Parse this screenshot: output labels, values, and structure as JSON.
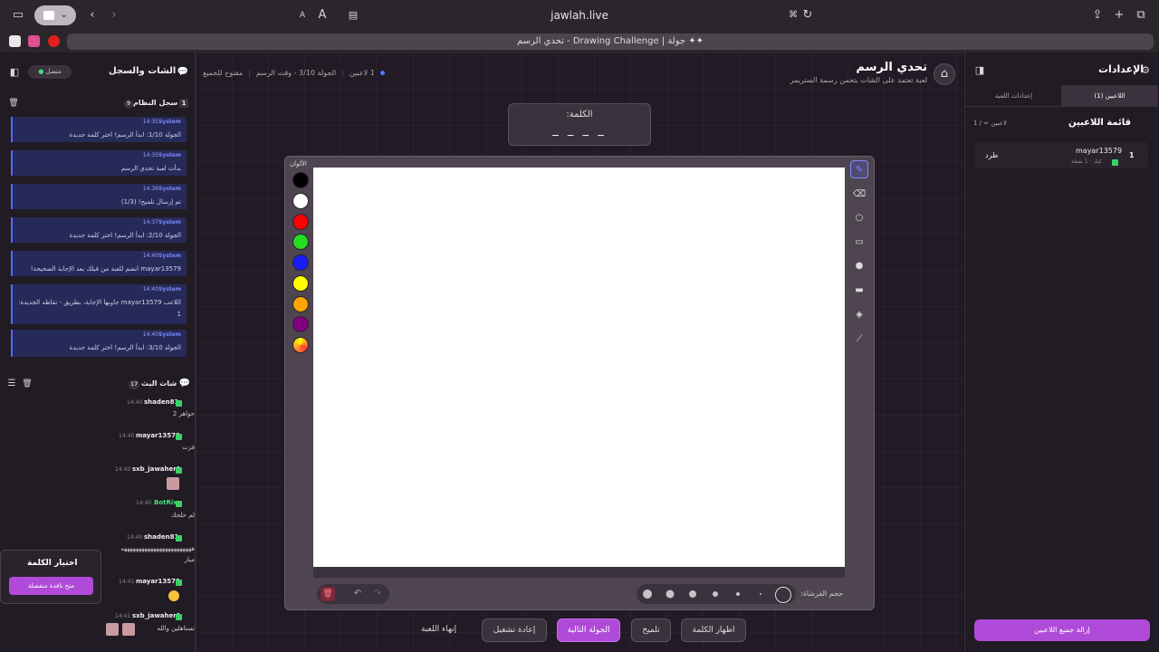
{
  "browser": {
    "url": "jawlah.live",
    "tab_title": "تحدي الرسم - Drawing Challenge | جولة ✦✦",
    "reader_a_small": "A",
    "reader_a_large": "A"
  },
  "header": {
    "title": "تحدي الرسم",
    "subtitle": "لعبة تعتمد على الشات بتخمن رسمة الستريمر",
    "players_count": "1 لاعبين",
    "round_info": "الجولة 3/10 - وقت الرسم",
    "access": "مفتوح للجميع"
  },
  "word_box": {
    "label": "الكلمة:",
    "dashes": "_ _ _ _"
  },
  "colors": {
    "label": "الألوان",
    "swatches": [
      "#000000",
      "#ffffff",
      "#ff0000",
      "#22dd22",
      "#1a1aff",
      "#ffff00",
      "#ffa500",
      "#800080"
    ]
  },
  "tools": [
    "pen-icon",
    "eraser-icon",
    "circle-icon",
    "rect-icon",
    "filled-circle-icon",
    "filled-rect-icon",
    "fill-bucket-icon",
    "line-icon"
  ],
  "brush": {
    "label": "حجم الفرشاة:"
  },
  "actions": {
    "show_word": "اظهار الكلمة",
    "hint": "تلميح",
    "next_round": "الجولة التالية",
    "restart": "إعادة تشغيل",
    "end_game": "إنهاء اللعبة"
  },
  "left_panel": {
    "title": "الشات والسجل",
    "online": "متصل",
    "system_log_title": "سجل النظام",
    "system_log_count": "9",
    "system_log_index": "1",
    "system_items": [
      {
        "name": "System",
        "time": "14:35",
        "text": "الجولة 1/10: ابدأ الرسم! اختر كلمة جديدة"
      },
      {
        "name": "System",
        "time": "14:35",
        "text": "بدأت لعبة تحدي الرسم"
      },
      {
        "name": "System",
        "time": "14:36",
        "text": "تم إرسال تلميح! (1/3)"
      },
      {
        "name": "System",
        "time": "14:37",
        "text": "الجولة 2/10: ابدأ الرسم! اختر كلمة جديدة"
      },
      {
        "name": "System",
        "time": "14:40",
        "text": "mayar13579 انضم للعبة من قبلك بعد الإجابة الصحيحة!"
      },
      {
        "name": "System",
        "time": "14:40",
        "text": "اللاعب mayar13579 جاوبها الإجابة، بطريق - نقاطه الجديدة: 1"
      },
      {
        "name": "System",
        "time": "14:40",
        "text": "الجولة 3/10: ابدأ الرسم! اختر كلمة جديدة"
      }
    ],
    "live_chat_title": "شات البث",
    "live_chat_count": "17",
    "chat": [
      {
        "name": "shaden81",
        "time": "14:40",
        "msg": "جواهر 2"
      },
      {
        "name": "mayar13579",
        "time": "14:40",
        "msg": "فزت"
      },
      {
        "name": "sxb_jawaher1",
        "time": "14:40",
        "msg": ""
      },
      {
        "name": "BotRix",
        "time": "14:40",
        "msg": "لم حلجك"
      },
      {
        "name": "shaden81",
        "time": "14:40",
        "msg": "ههههههههههههههههههههههههه"
      },
      {
        "name": "",
        "time": "",
        "msg": "ميار"
      },
      {
        "name": "mayar13579",
        "time": "14:41",
        "msg": ""
      },
      {
        "name": "sxb_jawaher1",
        "time": "14:41",
        "msg": "تستاهلين والله"
      }
    ],
    "choose_word": {
      "title": "اختيار الكلمة",
      "button": "منح نافذة منفصلة"
    }
  },
  "right_panel": {
    "title": "الإعدادات",
    "tab_players": "اللاعبين (1)",
    "tab_settings": "إعدادات اللعبة",
    "list_title": "قائمة اللاعبين",
    "list_count": "1 / ∞ لاعبين",
    "player": {
      "rank": "1",
      "name": "mayar13579",
      "meta": "كيك · 1 نقطة",
      "kick": "طرد"
    },
    "remove_all": "إزالة جميع اللاعبين"
  }
}
